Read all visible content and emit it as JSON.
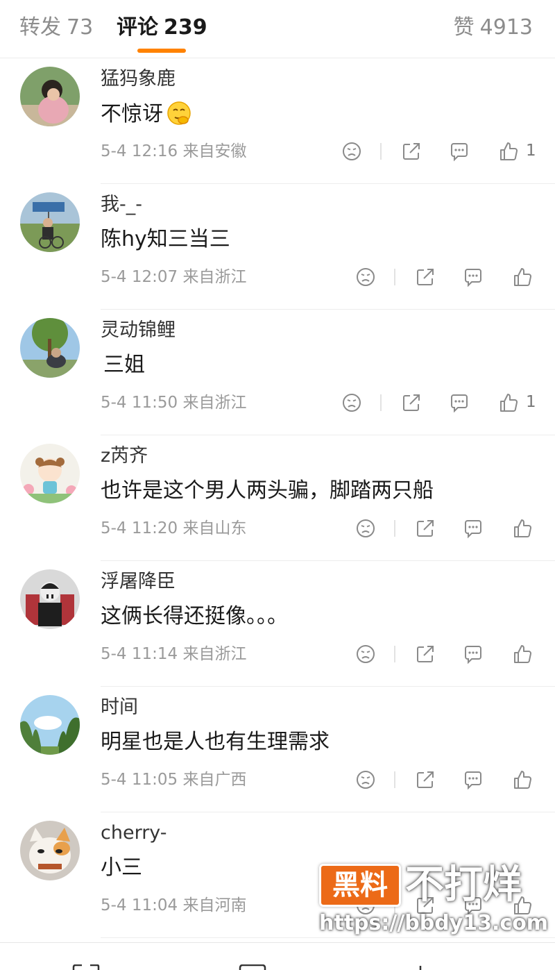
{
  "tabs": {
    "repost": {
      "label": "转发",
      "count": "73"
    },
    "comments": {
      "label": "评论",
      "count": "239"
    },
    "likes": {
      "label": "赞",
      "count": "4913"
    }
  },
  "comments": [
    {
      "username": "猛犸象鹿",
      "text": "不惊讶",
      "emoji": "thinking-emoji",
      "time": "5-4 12:16",
      "location": "来自安徽",
      "likes": "1"
    },
    {
      "username": "我-_-",
      "text": "陈hy知三当三",
      "time": "5-4 12:07",
      "location": "来自浙江",
      "likes": ""
    },
    {
      "username": "灵动锦鲤",
      "text": "三姐",
      "time": "5-4 11:50",
      "location": "来自浙江",
      "likes": "1"
    },
    {
      "username": "z芮齐",
      "text": "也许是这个男人两头骗，脚踏两只船",
      "time": "5-4 11:20",
      "location": "来自山东",
      "likes": ""
    },
    {
      "username": "浮屠降臣",
      "text": "这俩长得还挺像。。。",
      "time": "5-4 11:14",
      "location": "来自浙江",
      "likes": ""
    },
    {
      "username": "时间",
      "text": "明星也是人也有生理需求",
      "time": "5-4 11:05",
      "location": "来自广西",
      "likes": ""
    },
    {
      "username": "cherry-",
      "text": "小三",
      "time": "5-4 11:04",
      "location": "来自河南",
      "likes": ""
    }
  ],
  "watermark": {
    "badge": "黑料",
    "title": "不打烊",
    "url": "https://bbdy13.com"
  },
  "colors": {
    "accent": "#ff8200",
    "meta": "#9a9a9a",
    "watermark": "#ec6a17"
  }
}
